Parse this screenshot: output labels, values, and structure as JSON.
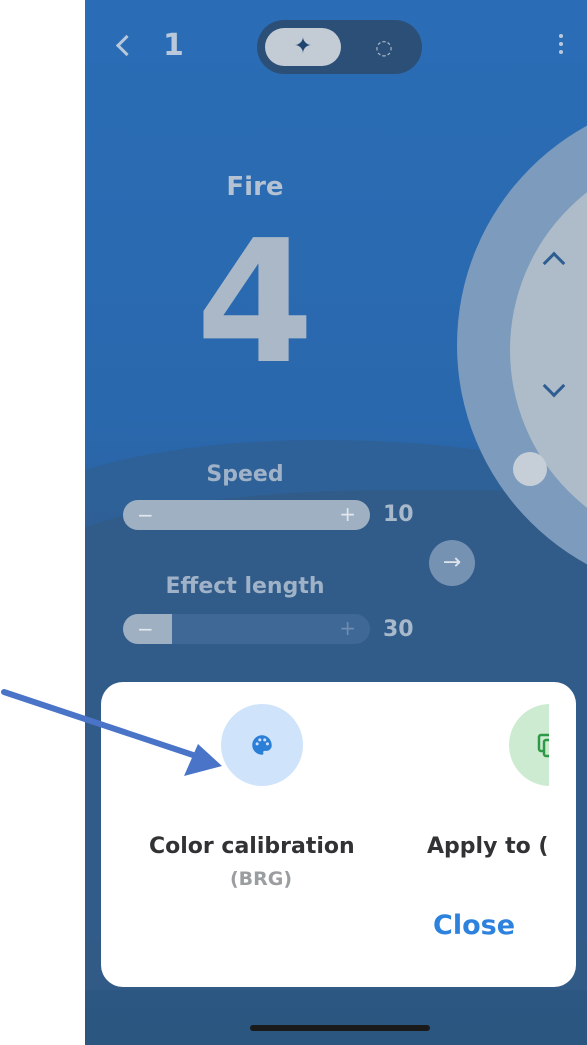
{
  "header": {
    "page_number": "1",
    "back_icon": "chevron-left-icon",
    "mode_active_icon": "sparkle-icon",
    "mode_inactive_icon": "palette-icon",
    "more_icon": "more-vertical-icon"
  },
  "effect": {
    "name": "Fire",
    "number": "4"
  },
  "speed": {
    "label": "Speed",
    "value": "10",
    "minus": "−",
    "plus": "+"
  },
  "effect_length": {
    "label": "Effect length",
    "value": "30",
    "minus": "−",
    "plus": "+",
    "fill_fraction": 0.2
  },
  "sheet": {
    "color_calibration": {
      "label": "Color calibration",
      "sub": "(BRG)",
      "icon": "palette-icon"
    },
    "apply_to": {
      "label": "Apply to (",
      "icon": "copy-icon"
    },
    "close_label": "Close"
  },
  "colors": {
    "accent": "#2d82dd",
    "background": "#2a68ad",
    "annotation_arrow": "#4a74c8"
  }
}
